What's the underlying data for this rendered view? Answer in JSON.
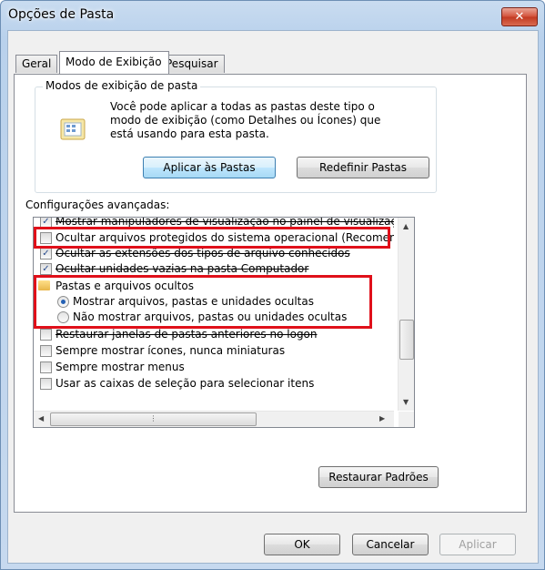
{
  "window": {
    "title": "Opções de Pasta",
    "close_glyph": "✕"
  },
  "tabs": [
    {
      "label": "Geral",
      "active": false
    },
    {
      "label": "Modo de Exibição",
      "active": true
    },
    {
      "label": "Pesquisar",
      "active": false
    }
  ],
  "folder_views": {
    "group_label": "Modos de exibição de pasta",
    "description": "Você pode aplicar a todas as pastas deste tipo o modo de exibição (como Detalhes ou Ícones) que está usando para esta pasta.",
    "apply_button": "Aplicar às Pastas",
    "reset_button": "Redefinir Pastas"
  },
  "advanced": {
    "label": "Configurações avançadas:",
    "items": [
      {
        "type": "checkbox",
        "checked": true,
        "label": "Mostrar manipuladores de visualização no painel de visualização",
        "struck": true
      },
      {
        "type": "checkbox",
        "checked": false,
        "label": "Ocultar arquivos protegidos do sistema operacional (Recomendado)",
        "struck": false
      },
      {
        "type": "checkbox",
        "checked": true,
        "label": "Ocultar as extensões dos tipos de arquivo conhecidos",
        "struck": true
      },
      {
        "type": "checkbox",
        "checked": true,
        "label": "Ocultar unidades vazias na pasta Computador",
        "struck": true
      },
      {
        "type": "folder",
        "label": "Pastas e arquivos ocultos",
        "struck": false
      },
      {
        "type": "radio",
        "selected": true,
        "label": "Mostrar arquivos, pastas e unidades ocultas",
        "struck": false
      },
      {
        "type": "radio",
        "selected": false,
        "label": "Não mostrar arquivos, pastas ou unidades ocultas",
        "struck": false
      },
      {
        "type": "checkbox",
        "checked": false,
        "label": "Restaurar janelas de pastas anteriores no logon",
        "struck": true
      },
      {
        "type": "checkbox",
        "checked": false,
        "label": "Sempre mostrar ícones, nunca miniaturas",
        "struck": false
      },
      {
        "type": "checkbox",
        "checked": false,
        "label": "Sempre mostrar menus",
        "struck": false
      },
      {
        "type": "checkbox",
        "checked": false,
        "label": "Usar as caixas de seleção para selecionar itens",
        "struck": false
      }
    ],
    "restore_defaults_button": "Restaurar Padrões"
  },
  "footer": {
    "ok": "OK",
    "cancel": "Cancelar",
    "apply": "Aplicar"
  },
  "colors": {
    "highlight": "#e0101a",
    "titlebar": "#b9d1ec",
    "close": "#c23a22"
  }
}
